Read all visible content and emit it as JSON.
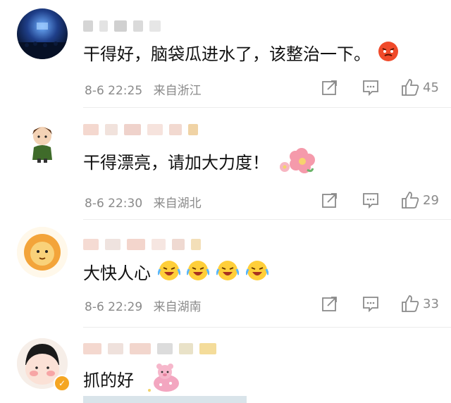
{
  "comments": [
    {
      "text": "干得好，脑袋瓜进水了，该整治一下。",
      "time": "8-6 22:25",
      "location": "来自浙江",
      "likes": "45",
      "avatar": "concert-crowd-avatar",
      "emojis": [
        "angry-face-emoji"
      ]
    },
    {
      "text": "干得漂亮，请加大力度！",
      "time": "8-6 22:30",
      "location": "来自湖北",
      "likes": "29",
      "avatar": "cartoon-boy-avatar",
      "emojis": [
        "flower-emoji"
      ]
    },
    {
      "text": "大快人心",
      "time": "8-6 22:29",
      "location": "来自湖南",
      "likes": "33",
      "avatar": "lion-avatar",
      "emojis": [
        "laughing-crying-emoji",
        "laughing-crying-emoji",
        "laughing-crying-emoji",
        "laughing-crying-emoji"
      ]
    },
    {
      "text": "抓的好",
      "avatar": "round-face-avatar",
      "emojis": [
        "pig-emoji"
      ]
    }
  ],
  "icons": {
    "share": "share-icon",
    "comment": "comment-icon",
    "like": "thumbs-up-icon",
    "verified": "verified-badge-icon"
  },
  "colors": {
    "meta_text": "#8a8a8a",
    "verified_badge": "#f5a623"
  }
}
